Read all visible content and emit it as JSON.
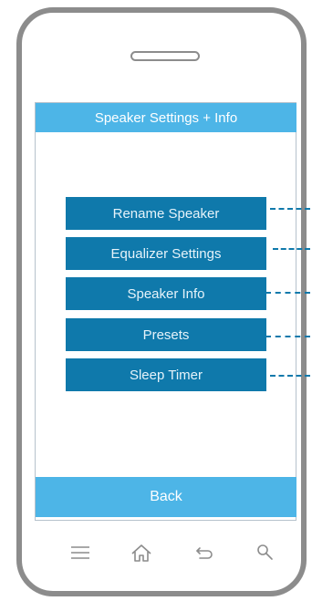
{
  "header": {
    "title": "Speaker Settings + Info"
  },
  "menu": {
    "items": [
      {
        "label": "Rename Speaker"
      },
      {
        "label": "Equalizer Settings"
      },
      {
        "label": "Speaker Info"
      },
      {
        "label": "Presets"
      },
      {
        "label": "Sleep Timer"
      }
    ]
  },
  "footer": {
    "back_label": "Back"
  },
  "nav_icons": [
    "menu-icon",
    "home-icon",
    "back-arrow-icon",
    "search-icon"
  ],
  "colors": {
    "title_bar": "#4db5e7",
    "menu_button": "#0f79ab",
    "back_button": "#4db5e7",
    "device_frame": "#8c8c8c",
    "connector": "#0f79ab"
  }
}
